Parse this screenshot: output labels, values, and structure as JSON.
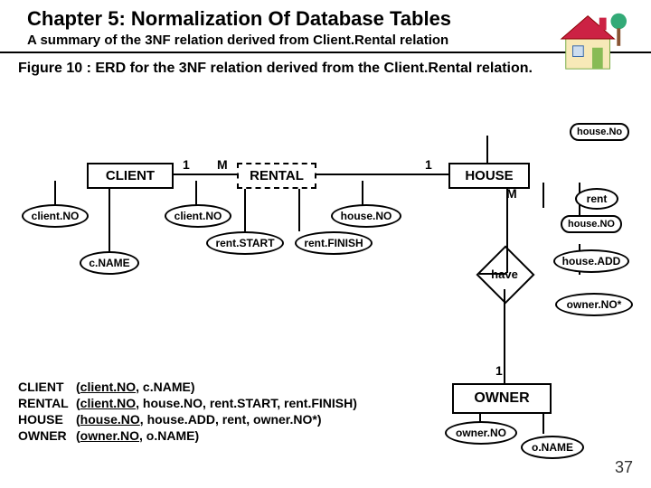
{
  "header": {
    "chapter_title": "Chapter 5: Normalization Of Database Tables",
    "subtitle": "A summary of the 3NF relation derived from Client.Rental relation"
  },
  "figure_caption": "Figure 10 : ERD for the 3NF relation derived from the Client.Rental relation.",
  "entities": {
    "client": "CLIENT",
    "rental": "RENTAL",
    "house": "HOUSE",
    "owner": "OWNER"
  },
  "attributes": {
    "client_no_left": "client.NO",
    "c_name": "c.NAME",
    "client_no_mid": "client.NO",
    "rent_start": "rent.START",
    "rent_finish": "rent.FINISH",
    "house_no_mid": "house.NO",
    "house_no_top": "house.No",
    "house_no_right": "house.NO",
    "rent": "rent",
    "house_add": "house.ADD",
    "owner_no_star": "owner.NO*",
    "owner_no": "owner.NO",
    "o_name": "o.NAME"
  },
  "cardinalities": {
    "one_a": "1",
    "m_a": "M",
    "one_b": "1",
    "m_b": "M",
    "one_c": "1"
  },
  "relationships": {
    "have": "have"
  },
  "legend": {
    "rows": [
      {
        "name": "CLIENT",
        "def_pre": "(",
        "key": "client.NO",
        "rest": ", c.NAME)"
      },
      {
        "name": "RENTAL",
        "def_pre": "(",
        "key": "client.NO",
        "rest": ", house.NO, rent.START, rent.FINISH)"
      },
      {
        "name": "HOUSE",
        "def_pre": "(",
        "key": "house.NO",
        "rest": ", house.ADD, rent, owner.NO*)"
      },
      {
        "name": "OWNER",
        "def_pre": "(",
        "key": "owner.NO",
        "rest": ", o.NAME)"
      }
    ]
  },
  "slide_number": "37"
}
